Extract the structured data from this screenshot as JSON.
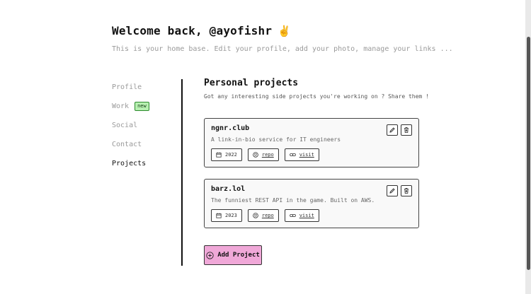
{
  "header": {
    "title": "Welcome back, @ayofishr",
    "emoji": "✌️",
    "subtitle": "This is your home base. Edit your profile, add your photo, manage your links ..."
  },
  "nav": {
    "items": [
      {
        "label": "Profile",
        "active": false
      },
      {
        "label": "Work",
        "active": false,
        "badge": "new"
      },
      {
        "label": "Social",
        "active": false
      },
      {
        "label": "Contact",
        "active": false
      },
      {
        "label": "Projects",
        "active": true
      }
    ]
  },
  "section": {
    "title": "Personal projects",
    "description": "Got any interesting side projects you're working on ? Share them !"
  },
  "projects": [
    {
      "name": "ngnr.club",
      "description": "A link-in-bio service for IT engineers",
      "year": "2022",
      "repo_label": "repo",
      "visit_label": "visit"
    },
    {
      "name": "barz.lol",
      "description": "The funniest REST API in the game. Built on AWS.",
      "year": "2023",
      "repo_label": "repo",
      "visit_label": "visit"
    }
  ],
  "actions": {
    "add_project": "Add Project"
  },
  "colors": {
    "accent": "#f0a8d8",
    "badge": "#b7f0b1"
  }
}
